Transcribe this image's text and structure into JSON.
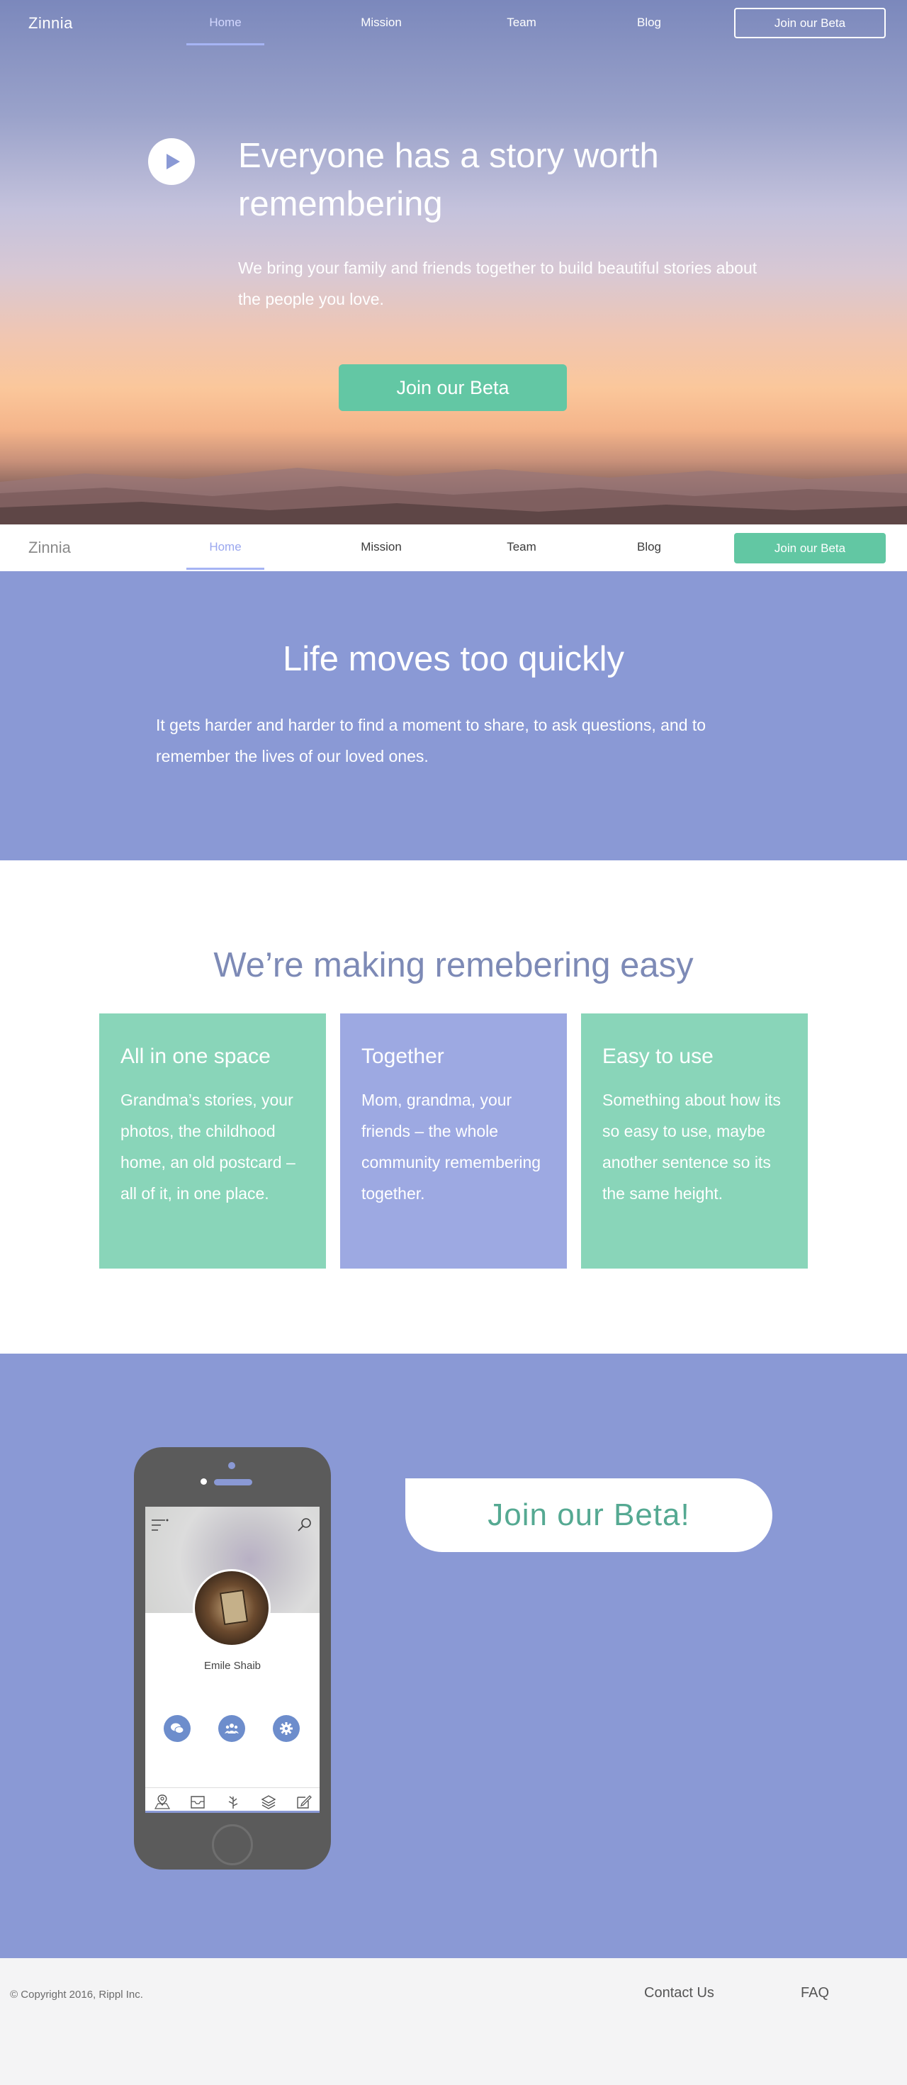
{
  "brand": "Zinnia",
  "nav": {
    "items": [
      "Home",
      "Mission",
      "Team",
      "Blog"
    ],
    "active": "Home",
    "cta": "Join our Beta"
  },
  "hero": {
    "title": "Everyone has a story worth remembering",
    "subtitle": "We bring your family and friends together to build beautiful stories about the people you love.",
    "cta": "Join our Beta"
  },
  "life": {
    "title": "Life moves too quickly",
    "text": "It gets harder and harder to find a moment to share, to ask questions, and to remember the lives of our loved ones."
  },
  "features": {
    "title": "We’re making remebering easy",
    "cards": [
      {
        "title": "All in one space",
        "text": "Grandma’s stories, your photos, the childhood home, an old postcard – all of it, in one place.",
        "color": "#89d5b9"
      },
      {
        "title": "Together",
        "text": "Mom, grandma, your friends – the whole community remembering together.",
        "color": "#9da9e2"
      },
      {
        "title": "Easy to use",
        "text": "Something about how its so easy to use, maybe another sentence so its the same height.",
        "color": "#89d5b9"
      }
    ]
  },
  "beta": {
    "cta": "Join our Beta!",
    "phone": {
      "user_name": "Emile Shaib",
      "actions": [
        "chat-icon",
        "people-icon",
        "settings-gear-icon"
      ],
      "tabs": [
        "map-pin-icon",
        "inbox-icon",
        "tree-icon",
        "layers-icon",
        "compose-icon"
      ]
    }
  },
  "footer": {
    "copyright": "© Copyright 2016, Rippl Inc.",
    "links": [
      "Contact Us",
      "FAQ"
    ]
  },
  "colors": {
    "accent_green": "#63c7a4",
    "periwinkle": "#8a99d5",
    "heading_blue": "#7d8ab6"
  }
}
